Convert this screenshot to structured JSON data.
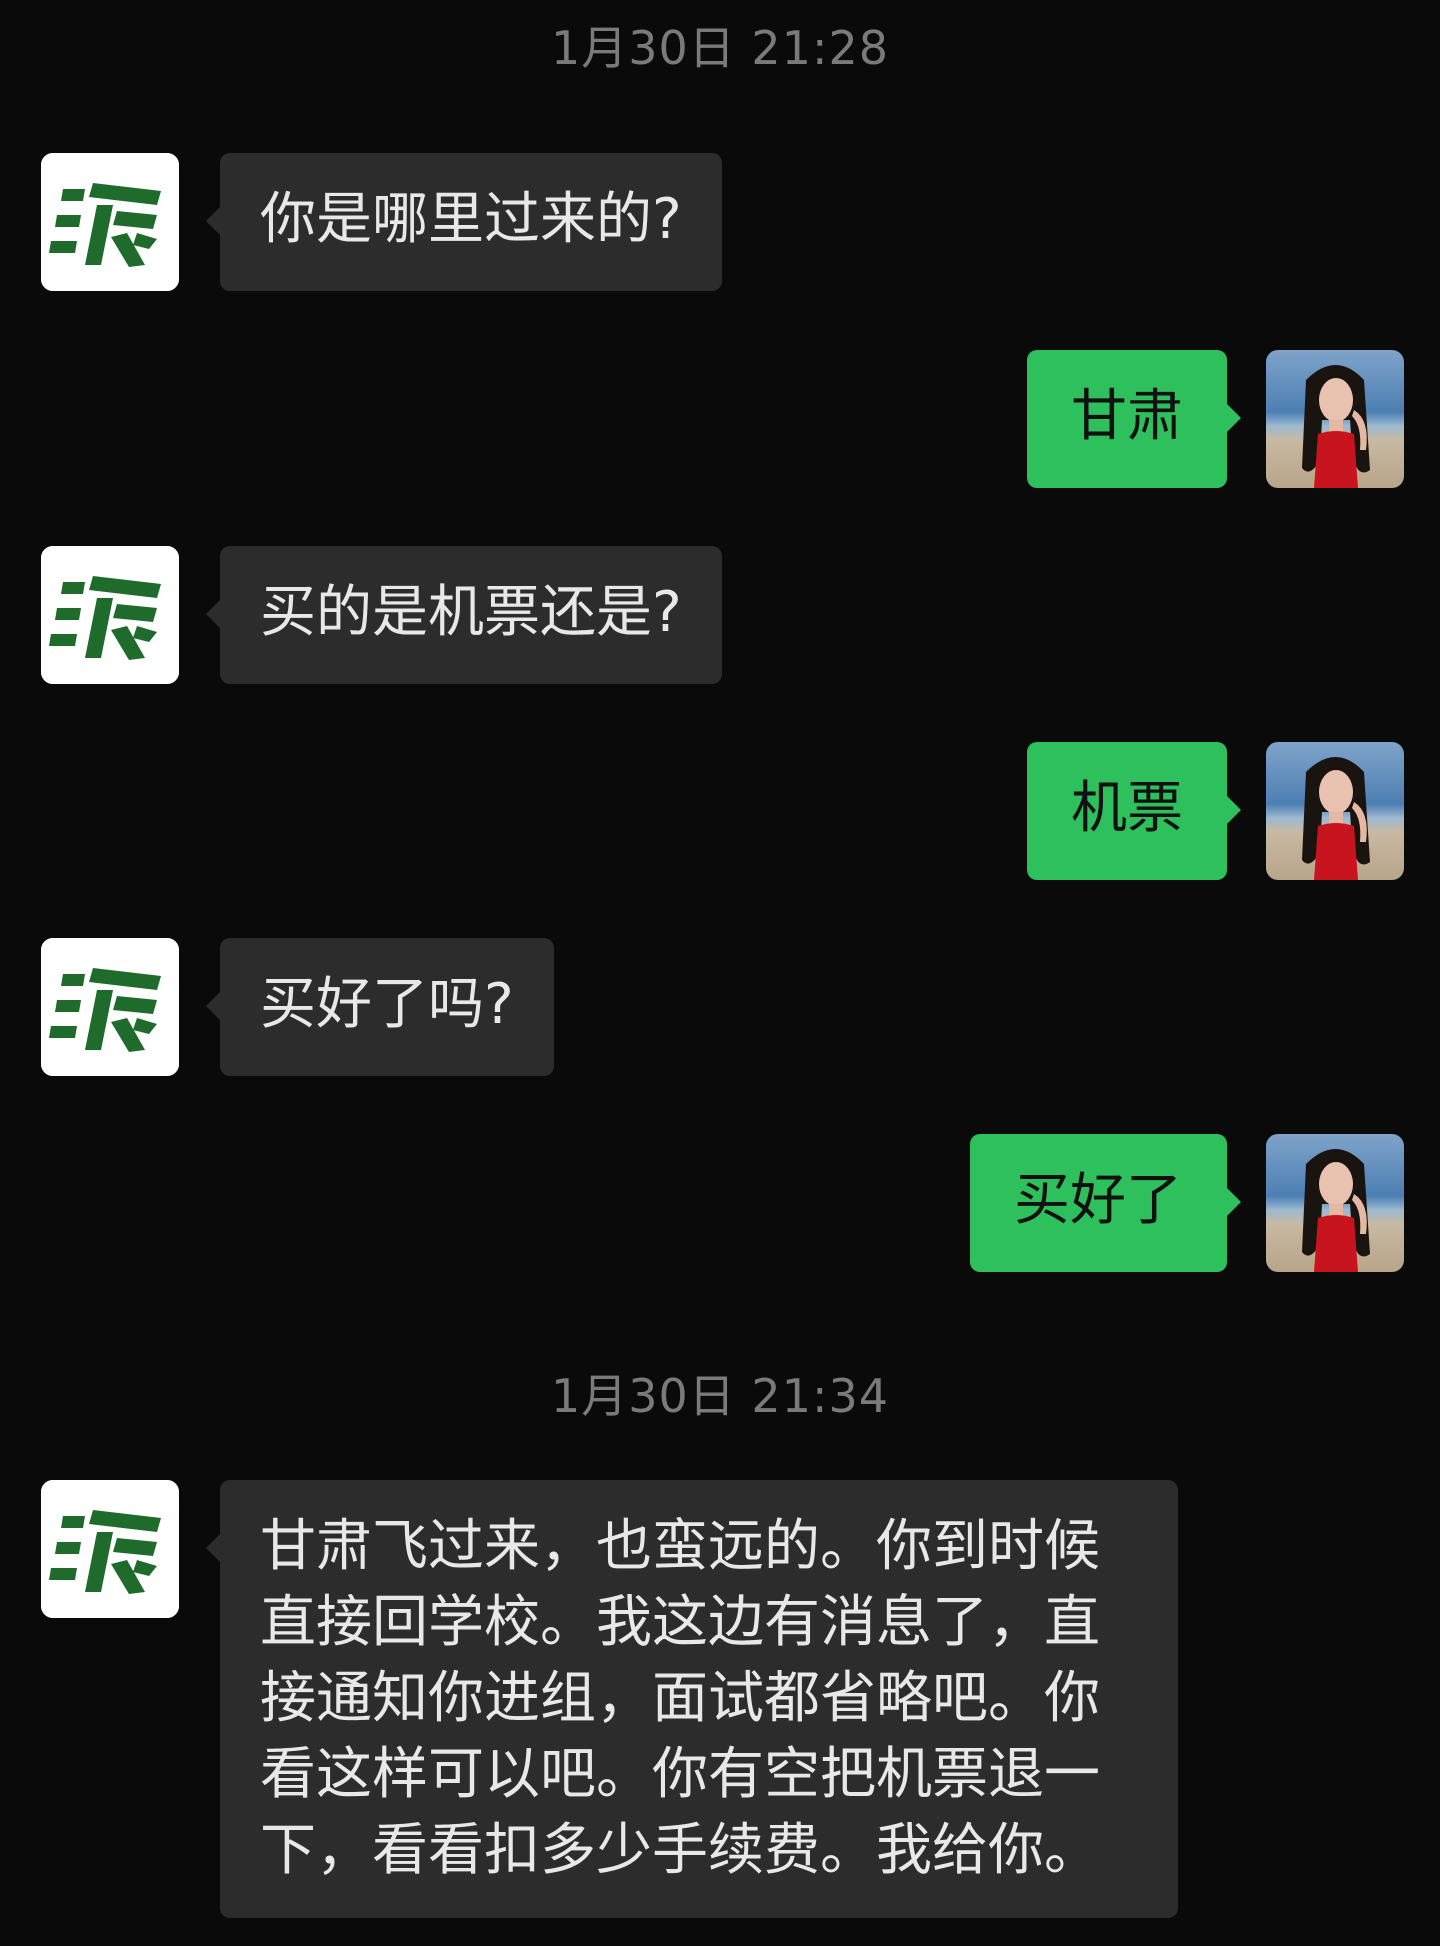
{
  "timestamps": [
    "1月30日 21:28",
    "1月30日 21:34"
  ],
  "messages": [
    {
      "side": "in",
      "text": "你是哪里过来的?"
    },
    {
      "side": "out",
      "text": "甘肃"
    },
    {
      "side": "in",
      "text": "买的是机票还是?"
    },
    {
      "side": "out",
      "text": "机票"
    },
    {
      "side": "in",
      "text": "买好了吗?"
    },
    {
      "side": "out",
      "text": "买好了"
    },
    {
      "side": "in",
      "text": "甘肃飞过来，也蛮远的。你到时候直接回学校。我这边有消息了，直接通知你进组，面试都省略吧。你看这样可以吧。你有空把机票退一下，看看扣多少手续费。我给你。"
    }
  ],
  "colors": {
    "background": "#0a0a0a",
    "incoming_bubble": "#2c2c2c",
    "outgoing_bubble": "#2dc05c",
    "timestamp": "#7a7a7a",
    "logo_green": "#1e6b2c"
  },
  "icons": {
    "contact_avatar": "green-logo-icon",
    "user_avatar": "portrait-photo"
  }
}
